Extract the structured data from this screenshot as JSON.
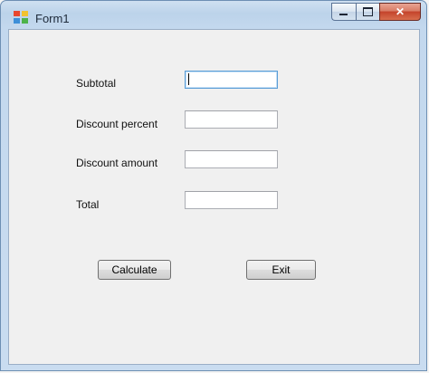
{
  "window": {
    "title": "Form1",
    "controls": {
      "minimize": "minimize",
      "maximize": "maximize",
      "close": "✕"
    }
  },
  "form": {
    "fields": [
      {
        "label": "Subtotal",
        "value": ""
      },
      {
        "label": "Discount percent",
        "value": ""
      },
      {
        "label": "Discount amount",
        "value": ""
      },
      {
        "label": "Total",
        "value": ""
      }
    ],
    "buttons": {
      "calculate": "Calculate",
      "exit": "Exit"
    }
  }
}
